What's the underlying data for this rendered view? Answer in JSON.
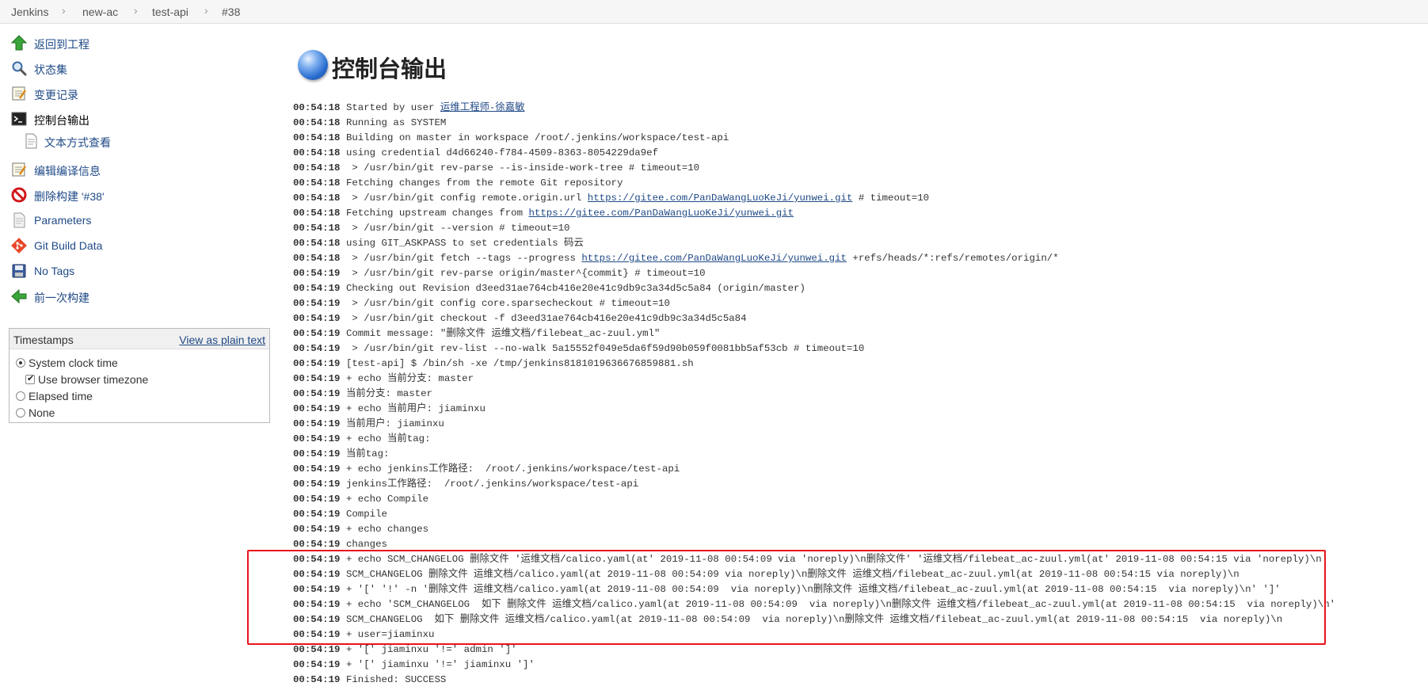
{
  "breadcrumb": [
    "Jenkins",
    "new-ac",
    "test-api",
    "#38"
  ],
  "sidebar": {
    "items": [
      {
        "label": "返回到工程",
        "icon": "up-arrow-icon"
      },
      {
        "label": "状态集",
        "icon": "magnifier-icon"
      },
      {
        "label": "变更记录",
        "icon": "notepad-icon"
      },
      {
        "label": "控制台输出",
        "icon": "terminal-icon"
      },
      {
        "label": "文本方式查看",
        "icon": "document-icon"
      },
      {
        "label": "编辑编译信息",
        "icon": "notepad-icon"
      },
      {
        "label": "删除构建 '#38'",
        "icon": "no-entry-icon"
      },
      {
        "label": "Parameters",
        "icon": "document-icon"
      },
      {
        "label": "Git Build Data",
        "icon": "git-icon"
      },
      {
        "label": "No Tags",
        "icon": "floppy-disk-icon"
      },
      {
        "label": "前一次构建",
        "icon": "left-arrow-icon"
      }
    ]
  },
  "timestamps": {
    "title": "Timestamps",
    "view_plain_text": "View as plain text",
    "options": [
      {
        "label": "System clock time",
        "type": "radio",
        "checked": true
      },
      {
        "label": "Use browser timezone",
        "type": "checkbox",
        "checked": true
      },
      {
        "label": "Elapsed time",
        "type": "radio",
        "checked": false
      },
      {
        "label": "None",
        "type": "radio",
        "checked": false
      }
    ]
  },
  "main": {
    "title": "控制台输出",
    "console": [
      {
        "t": "00:54:18",
        "pre": "Started by user ",
        "link": "运维工程师-徐嘉敏",
        "post": ""
      },
      {
        "t": "00:54:18",
        "pre": "Running as SYSTEM",
        "link": "",
        "post": ""
      },
      {
        "t": "00:54:18",
        "pre": "Building on master in workspace /root/.jenkins/workspace/test-api",
        "link": "",
        "post": ""
      },
      {
        "t": "00:54:18",
        "pre": "using credential d4d66240-f784-4509-8363-8054229da9ef",
        "link": "",
        "post": ""
      },
      {
        "t": "00:54:18",
        "pre": " > /usr/bin/git rev-parse --is-inside-work-tree # timeout=10",
        "link": "",
        "post": ""
      },
      {
        "t": "00:54:18",
        "pre": "Fetching changes from the remote Git repository",
        "link": "",
        "post": ""
      },
      {
        "t": "00:54:18",
        "pre": " > /usr/bin/git config remote.origin.url ",
        "link": "https://gitee.com/PanDaWangLuoKeJi/yunwei.git",
        "post": " # timeout=10"
      },
      {
        "t": "00:54:18",
        "pre": "Fetching upstream changes from ",
        "link": "https://gitee.com/PanDaWangLuoKeJi/yunwei.git",
        "post": ""
      },
      {
        "t": "00:54:18",
        "pre": " > /usr/bin/git --version # timeout=10",
        "link": "",
        "post": ""
      },
      {
        "t": "00:54:18",
        "pre": "using GIT_ASKPASS to set credentials 码云",
        "link": "",
        "post": ""
      },
      {
        "t": "00:54:18",
        "pre": " > /usr/bin/git fetch --tags --progress ",
        "link": "https://gitee.com/PanDaWangLuoKeJi/yunwei.git",
        "post": " +refs/heads/*:refs/remotes/origin/*"
      },
      {
        "t": "00:54:19",
        "pre": " > /usr/bin/git rev-parse origin/master^{commit} # timeout=10",
        "link": "",
        "post": ""
      },
      {
        "t": "00:54:19",
        "pre": "Checking out Revision d3eed31ae764cb416e20e41c9db9c3a34d5c5a84 (origin/master)",
        "link": "",
        "post": ""
      },
      {
        "t": "00:54:19",
        "pre": " > /usr/bin/git config core.sparsecheckout # timeout=10",
        "link": "",
        "post": ""
      },
      {
        "t": "00:54:19",
        "pre": " > /usr/bin/git checkout -f d3eed31ae764cb416e20e41c9db9c3a34d5c5a84",
        "link": "",
        "post": ""
      },
      {
        "t": "00:54:19",
        "pre": "Commit message: \"删除文件 运维文档/filebeat_ac-zuul.yml\"",
        "link": "",
        "post": ""
      },
      {
        "t": "00:54:19",
        "pre": " > /usr/bin/git rev-list --no-walk 5a15552f049e5da6f59d90b059f0081bb5af53cb # timeout=10",
        "link": "",
        "post": ""
      },
      {
        "t": "00:54:19",
        "pre": "[test-api] $ /bin/sh -xe /tmp/jenkins8181019636676859881.sh",
        "link": "",
        "post": ""
      },
      {
        "t": "00:54:19",
        "pre": "+ echo 当前分支: master",
        "link": "",
        "post": ""
      },
      {
        "t": "00:54:19",
        "pre": "当前分支: master",
        "link": "",
        "post": ""
      },
      {
        "t": "00:54:19",
        "pre": "+ echo 当前用户: jiaminxu",
        "link": "",
        "post": ""
      },
      {
        "t": "00:54:19",
        "pre": "当前用户: jiaminxu",
        "link": "",
        "post": ""
      },
      {
        "t": "00:54:19",
        "pre": "+ echo 当前tag:",
        "link": "",
        "post": ""
      },
      {
        "t": "00:54:19",
        "pre": "当前tag:",
        "link": "",
        "post": ""
      },
      {
        "t": "00:54:19",
        "pre": "+ echo jenkins工作路径:  /root/.jenkins/workspace/test-api",
        "link": "",
        "post": ""
      },
      {
        "t": "00:54:19",
        "pre": "jenkins工作路径:  /root/.jenkins/workspace/test-api",
        "link": "",
        "post": ""
      },
      {
        "t": "00:54:19",
        "pre": "+ echo Compile",
        "link": "",
        "post": ""
      },
      {
        "t": "00:54:19",
        "pre": "Compile",
        "link": "",
        "post": ""
      },
      {
        "t": "00:54:19",
        "pre": "+ echo changes",
        "link": "",
        "post": ""
      },
      {
        "t": "00:54:19",
        "pre": "changes",
        "link": "",
        "post": ""
      },
      {
        "t": "00:54:19",
        "pre": "+ echo SCM_CHANGELOG 删除文件 '运维文档/calico.yaml(at' 2019-11-08 00:54:09 via 'noreply)\\n删除文件' '运维文档/filebeat_ac-zuul.yml(at' 2019-11-08 00:54:15 via 'noreply)\\n'",
        "link": "",
        "post": ""
      },
      {
        "t": "00:54:19",
        "pre": "SCM_CHANGELOG 删除文件 运维文档/calico.yaml(at 2019-11-08 00:54:09 via noreply)\\n删除文件 运维文档/filebeat_ac-zuul.yml(at 2019-11-08 00:54:15 via noreply)\\n",
        "link": "",
        "post": ""
      },
      {
        "t": "00:54:19",
        "pre": "+ '[' '!' -n '删除文件 运维文档/calico.yaml(at 2019-11-08 00:54:09  via noreply)\\n删除文件 运维文档/filebeat_ac-zuul.yml(at 2019-11-08 00:54:15  via noreply)\\n' ']'",
        "link": "",
        "post": ""
      },
      {
        "t": "00:54:19",
        "pre": "+ echo 'SCM_CHANGELOG  如下 删除文件 运维文档/calico.yaml(at 2019-11-08 00:54:09  via noreply)\\n删除文件 运维文档/filebeat_ac-zuul.yml(at 2019-11-08 00:54:15  via noreply)\\n'",
        "link": "",
        "post": ""
      },
      {
        "t": "00:54:19",
        "pre": "SCM_CHANGELOG  如下 删除文件 运维文档/calico.yaml(at 2019-11-08 00:54:09  via noreply)\\n删除文件 运维文档/filebeat_ac-zuul.yml(at 2019-11-08 00:54:15  via noreply)\\n",
        "link": "",
        "post": ""
      },
      {
        "t": "00:54:19",
        "pre": "+ user=jiaminxu",
        "link": "",
        "post": ""
      },
      {
        "t": "00:54:19",
        "pre": "+ '[' jiaminxu '!=' admin ']'",
        "link": "",
        "post": ""
      },
      {
        "t": "00:54:19",
        "pre": "+ '[' jiaminxu '!=' jiaminxu ']'",
        "link": "",
        "post": ""
      },
      {
        "t": "00:54:19",
        "pre": "Finished: SUCCESS",
        "link": "",
        "post": ""
      }
    ]
  }
}
